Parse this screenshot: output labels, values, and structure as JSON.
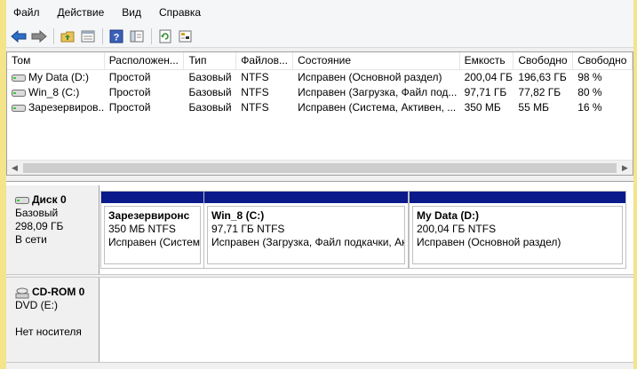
{
  "menu": [
    "Файл",
    "Действие",
    "Вид",
    "Справка"
  ],
  "toolbar": [
    "back-arrow-icon",
    "forward-arrow-icon",
    "up-folder-icon",
    "properties-icon",
    "help-icon",
    "show-hide-icon",
    "refresh-icon",
    "settings-icon"
  ],
  "columns": [
    "Том",
    "Расположен...",
    "Тип",
    "Файлов...",
    "Состояние",
    "Емкость",
    "Свободно",
    "Свободно"
  ],
  "volumes": [
    {
      "name": "My Data (D:)",
      "layout": "Простой",
      "type": "Базовый",
      "fs": "NTFS",
      "status": "Исправен (Основной раздел)",
      "capacity": "200,04 ГБ",
      "free": "196,63 ГБ",
      "free_pct": "98 %"
    },
    {
      "name": "Win_8 (C:)",
      "layout": "Простой",
      "type": "Базовый",
      "fs": "NTFS",
      "status": "Исправен (Загрузка, Файл под...",
      "capacity": "97,71 ГБ",
      "free": "77,82 ГБ",
      "free_pct": "80 %"
    },
    {
      "name": "Зарезервиров...",
      "layout": "Простой",
      "type": "Базовый",
      "fs": "NTFS",
      "status": "Исправен (Система, Активен, ...",
      "capacity": "350 МБ",
      "free": "55 МБ",
      "free_pct": "16 %"
    }
  ],
  "disk0": {
    "title": "Диск 0",
    "type": "Базовый",
    "size": "298,09 ГБ",
    "state": "В сети"
  },
  "partitions": [
    {
      "name": "Зарезервиронс",
      "size": "350 МБ NTFS",
      "status": "Исправен (Систем"
    },
    {
      "name": "Win_8  (C:)",
      "size": "97,71 ГБ NTFS",
      "status": "Исправен (Загрузка, Файл подкачки, Ак"
    },
    {
      "name": "My Data  (D:)",
      "size": "200,04 ГБ NTFS",
      "status": "Исправен (Основной раздел)"
    }
  ],
  "cdrom": {
    "title": "CD-ROM 0",
    "drive": "DVD (E:)",
    "media": "Нет носителя"
  },
  "colors": {
    "partition_bar": "#0a1a8a",
    "frame": "#f4e48a",
    "selection": "#cce8ff"
  }
}
